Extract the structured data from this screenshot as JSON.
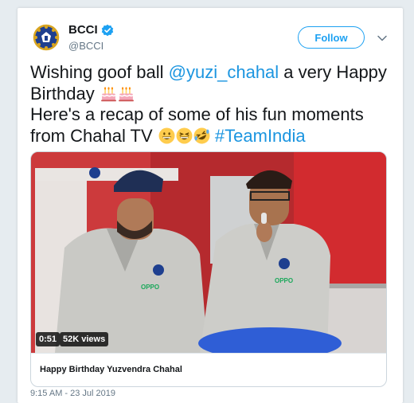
{
  "tweet": {
    "display_name": "BCCI",
    "handle": "@BCCI",
    "follow_label": "Follow",
    "text": {
      "t1": "Wishing goof ball ",
      "mention": "@yuzi_chahal",
      "t2": " a very Happy Birthday ",
      "t3": "Here's a recap of some of his fun moments from Chahal TV ",
      "hashtag": "#TeamIndia"
    },
    "emojis": [
      "birthday-cake-icon",
      "birthday-cake-icon",
      "grinning-face-icon",
      "laughing-face-icon",
      "rolling-laughing-face-icon"
    ],
    "timestamp": "9:15 AM - 23 Jul 2019"
  },
  "media": {
    "duration": "0:51",
    "views": "52K views",
    "title": "Happy Birthday Yuzvendra Chahal",
    "jersey_logo": "OPPO"
  },
  "colors": {
    "accent": "#1da1f2",
    "link": "#1b95e0",
    "text": "#14171a",
    "muted": "#657786",
    "background": "#e6ecf0",
    "video_red": "#c8262c"
  }
}
